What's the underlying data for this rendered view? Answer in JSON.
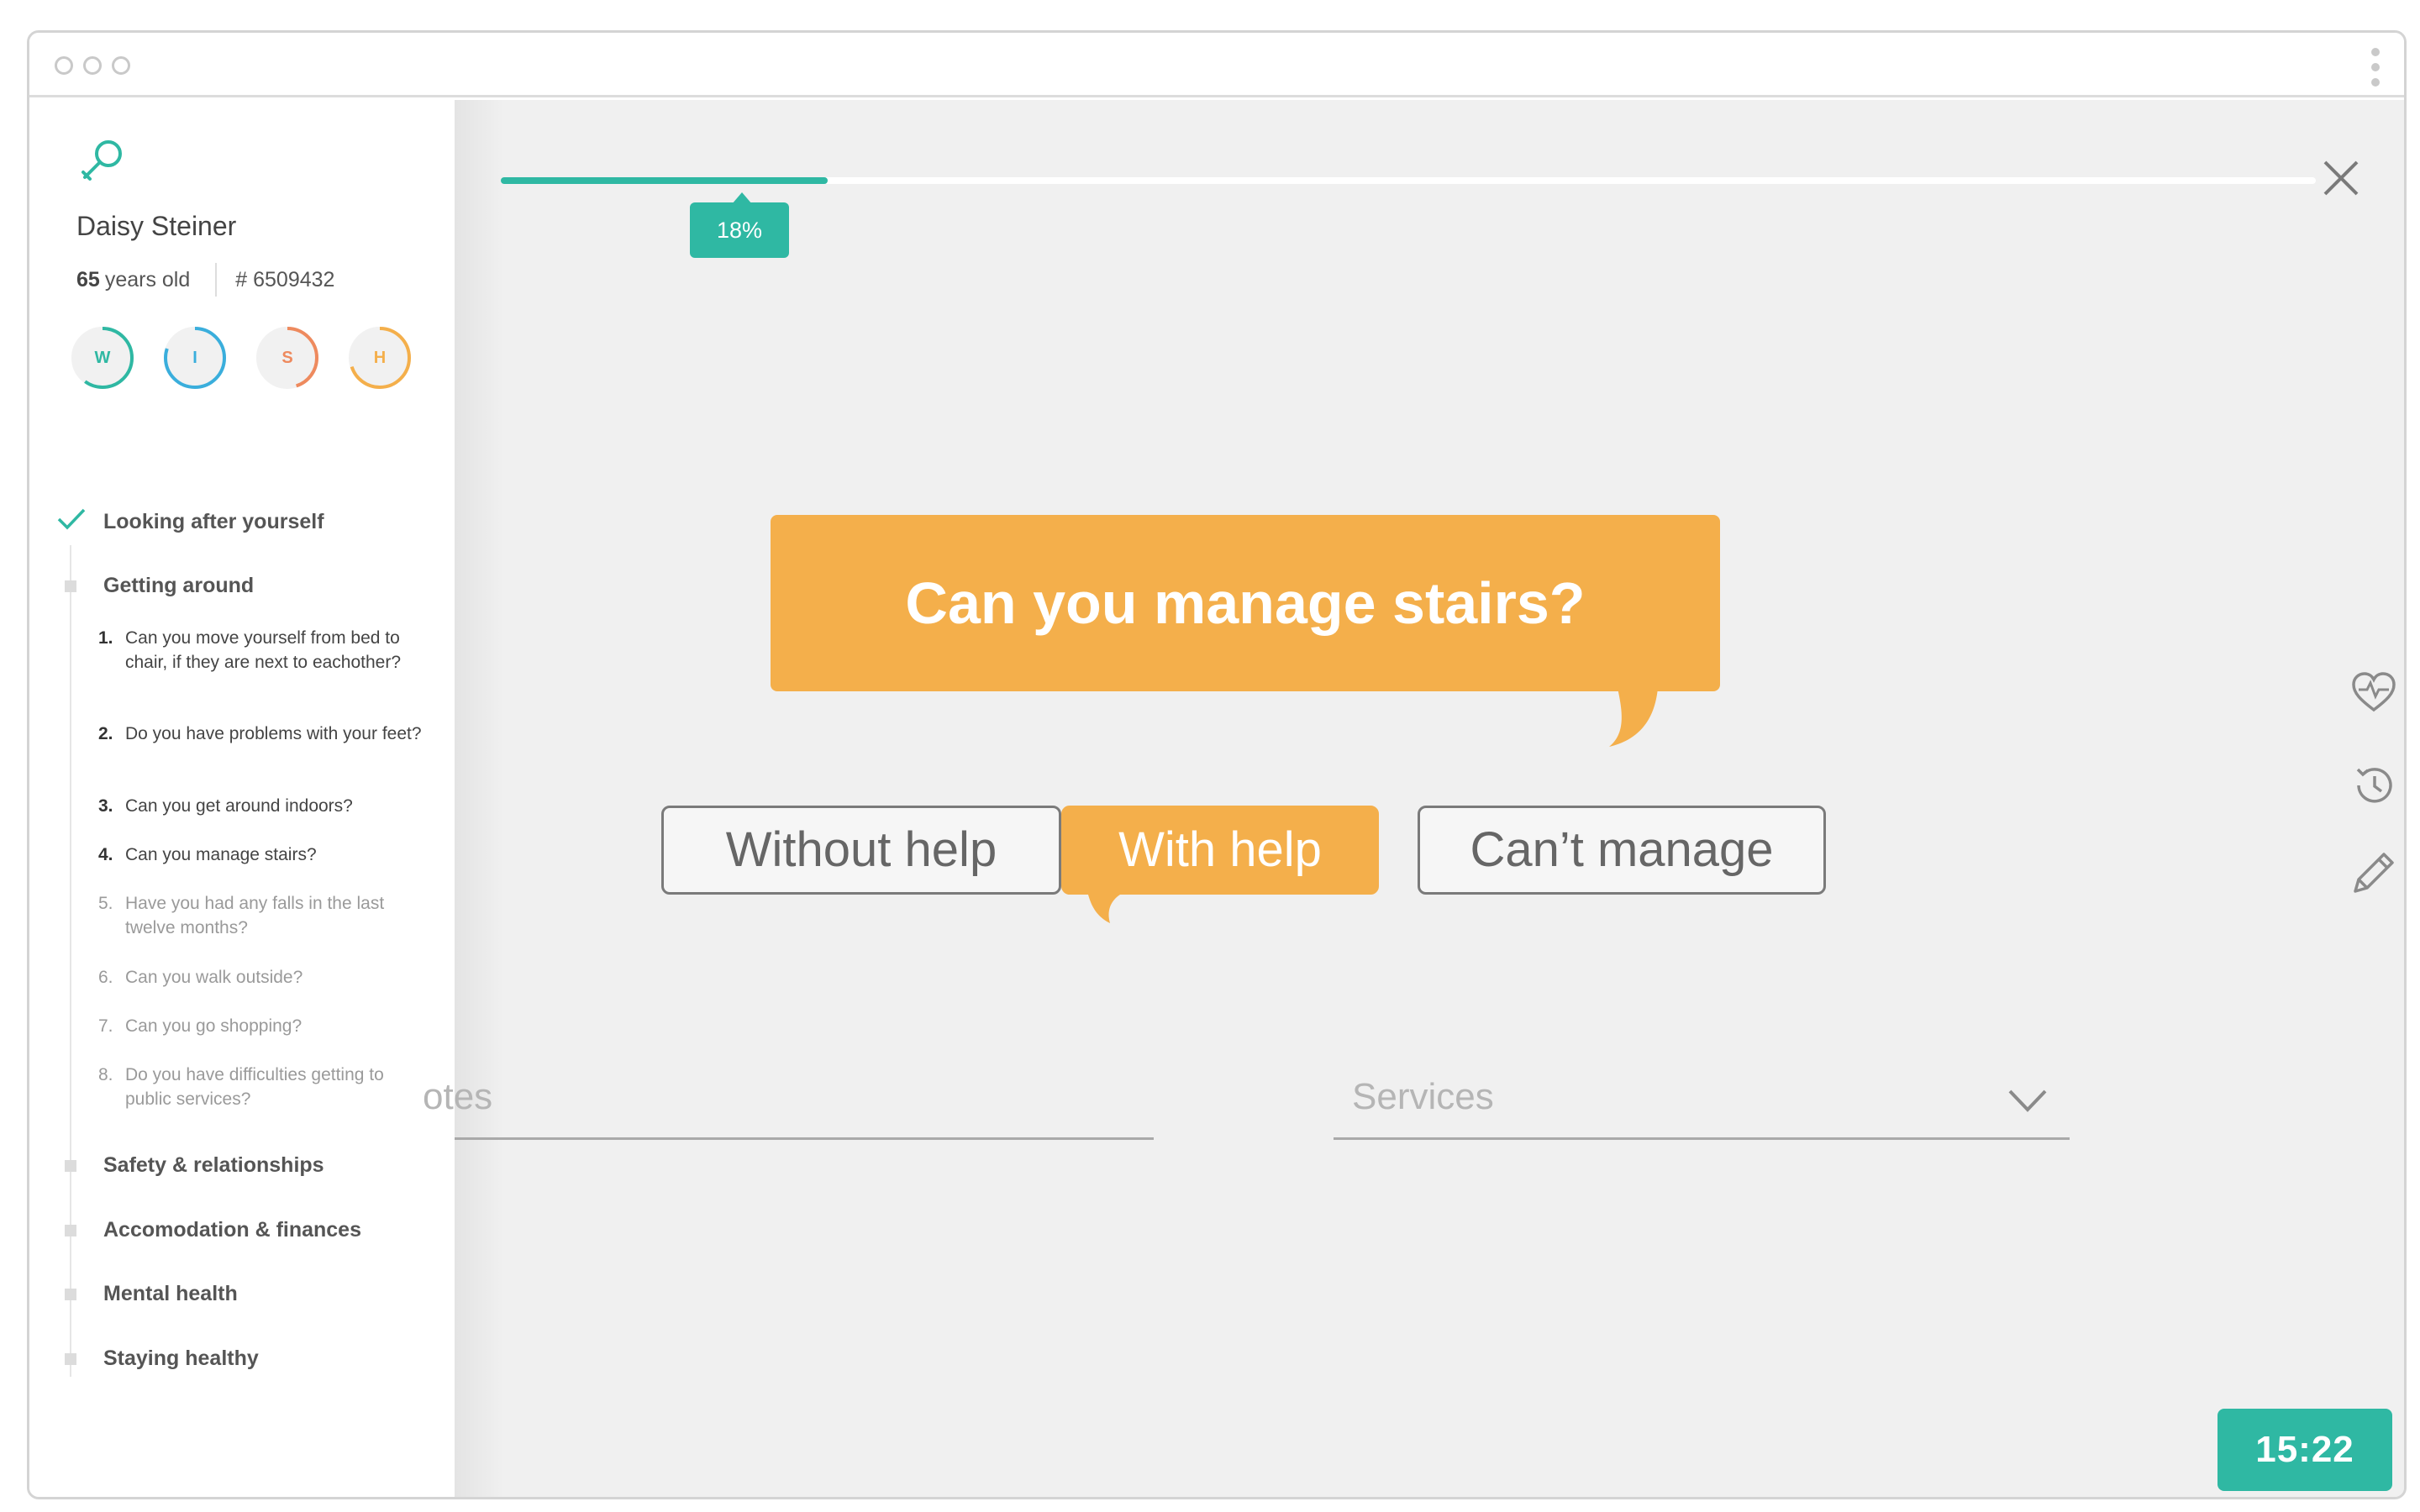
{
  "patient": {
    "name": "Daisy Steiner",
    "age_value": "65",
    "age_suffix": "years old",
    "id": "# 6509432"
  },
  "rings": [
    {
      "letter": "W",
      "color": "#2fb8a3",
      "fraction": 0.6
    },
    {
      "letter": "I",
      "color": "#3aaedc",
      "fraction": 0.8
    },
    {
      "letter": "S",
      "color": "#ee8a5e",
      "fraction": 0.45
    },
    {
      "letter": "H",
      "color": "#f4af4b",
      "fraction": 0.7
    }
  ],
  "nav": {
    "sections": [
      {
        "label": "Looking after yourself",
        "state": "done"
      },
      {
        "label": "Getting around",
        "state": "active"
      },
      {
        "label": "Safety & relationships",
        "state": "pending"
      },
      {
        "label": "Accomodation & finances",
        "state": "pending"
      },
      {
        "label": "Mental health",
        "state": "pending"
      },
      {
        "label": "Staying healthy",
        "state": "pending"
      }
    ],
    "questions": [
      {
        "num": "1.",
        "text": "Can you move yourself from bed to chair, if they are next to eachother?",
        "answered": true
      },
      {
        "num": "2.",
        "text": "Do you have problems with your feet?",
        "answered": true
      },
      {
        "num": "3.",
        "text": "Can you get around indoors?",
        "answered": true
      },
      {
        "num": "4.",
        "text": "Can you manage stairs?",
        "answered": true
      },
      {
        "num": "5.",
        "text": "Have you had any falls in the last twelve months?",
        "answered": false
      },
      {
        "num": "6.",
        "text": "Can you walk outside?",
        "answered": false
      },
      {
        "num": "7.",
        "text": "Can you go shopping?",
        "answered": false
      },
      {
        "num": "8.",
        "text": "Do you have difficulties getting to public services?",
        "answered": false
      }
    ]
  },
  "progress": {
    "percent_label": "18%",
    "fraction": 0.18
  },
  "question": "Can you manage stairs?",
  "answers": {
    "without_help": "Without help",
    "with_help": "With help",
    "cant_manage": "Can’t manage",
    "selected": "with_help"
  },
  "fields": {
    "notes_placeholder": "Notes",
    "notes_visible": "otes",
    "services_placeholder": "Services"
  },
  "timer": "15:22",
  "colors": {
    "teal": "#2fb8a3",
    "orange": "#f4af4b",
    "blue": "#3aaedc",
    "coral": "#ee8a5e"
  },
  "icons": [
    "search-person-icon",
    "check-icon",
    "close-icon",
    "heart-pulse-icon",
    "history-icon",
    "pencil-icon",
    "chevron-down-icon"
  ]
}
